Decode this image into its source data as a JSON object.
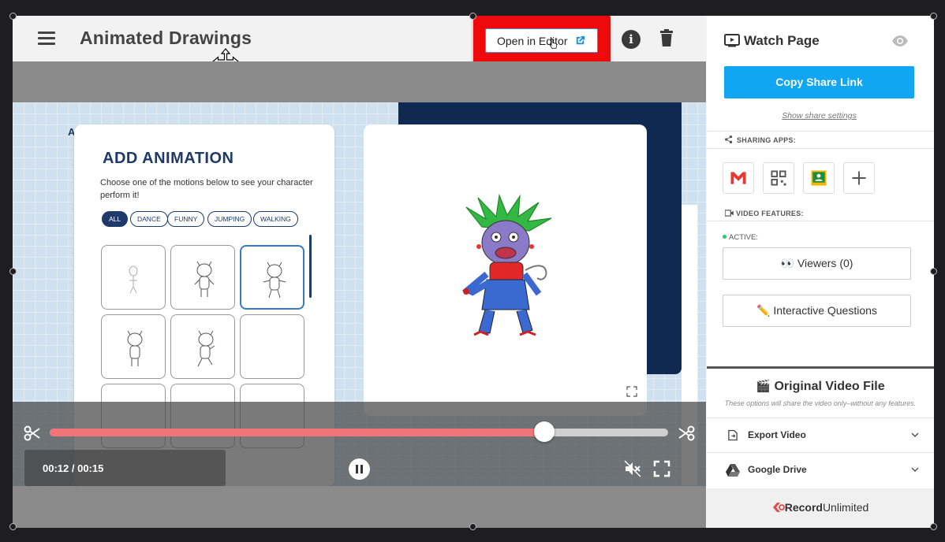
{
  "header": {
    "app_title": "Animated Drawings",
    "open_editor_label": "Open in Editor"
  },
  "animation_card": {
    "title": "ADD ANIMATION",
    "description": "Choose one of the motions below to see your character perform it!",
    "filters": [
      "ALL",
      "DANCE",
      "FUNNY",
      "JUMPING",
      "WALKING"
    ],
    "selected_filter": "ALL"
  },
  "player": {
    "time_display": "00:12 / 00:15",
    "progress": 0.8,
    "state": "playing",
    "muted": true
  },
  "sidebar": {
    "watch_title": "Watch Page",
    "copy_share_label": "Copy Share Link",
    "share_settings_link": "Show share settings",
    "sharing_apps_label": "SHARING APPS:",
    "apps": [
      {
        "name": "gmail-icon"
      },
      {
        "name": "qr-code-icon"
      },
      {
        "name": "google-classroom-icon"
      },
      {
        "name": "add-app-icon"
      }
    ],
    "video_features_label": "VIDEO FEATURES:",
    "active_label": "ACTIVE:",
    "viewers_label": "Viewers (0)",
    "questions_label": "Interactive Questions",
    "original_title": "Original Video File",
    "original_sub": "These options will share the video only–without any features.",
    "export_label": "Export Video",
    "drive_label": "Google Drive",
    "brand_bold": "Record",
    "brand_light": "Unlimited"
  },
  "colors": {
    "accent_blue": "#10a6f4",
    "highlight_red": "#ee0a0a",
    "progress_fill": "#f07478",
    "navy": "#1d3a6a"
  }
}
